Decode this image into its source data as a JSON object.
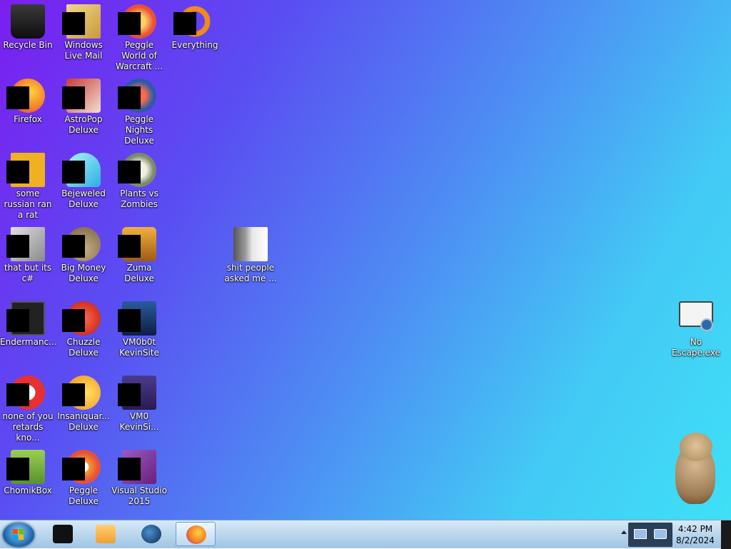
{
  "desktop": {
    "icons": [
      {
        "label": "Recycle Bin",
        "icon": "recycle-bin-icon",
        "color": "#1b1b1b"
      },
      {
        "label": "Windows Live Mail",
        "icon": "mail-icon",
        "color": "#d9b25a"
      },
      {
        "label": "Peggle World of Warcraft ...",
        "icon": "peggle-icon",
        "color": "#e8503a"
      },
      {
        "label": "Everything",
        "icon": "search-icon",
        "color": "#f08a1a"
      },
      {
        "label": "Firefox",
        "icon": "firefox-icon",
        "color": "#f2772a"
      },
      {
        "label": "AstroPop Deluxe",
        "icon": "astropop-icon",
        "color": "#c83a3a"
      },
      {
        "label": "Peggle Nights Deluxe",
        "icon": "peggle-nights-icon",
        "color": "#2a5aa8"
      },
      {
        "label": "some russian ran a rat",
        "icon": "image-icon",
        "color": "#f0b020"
      },
      {
        "label": "Bejeweled Deluxe",
        "icon": "gem-icon",
        "color": "#3ad0f0"
      },
      {
        "label": "Plants vs Zombies",
        "icon": "plant-icon",
        "color": "#8a9a7a"
      },
      {
        "label": "that but its c#",
        "icon": "documents-icon",
        "color": "#b8b8b8"
      },
      {
        "label": "Big Money Deluxe",
        "icon": "money-bag-icon",
        "color": "#b8a07a"
      },
      {
        "label": "Zuma Deluxe",
        "icon": "zuma-icon",
        "color": "#d08a2a"
      },
      {
        "label": "shit people asked me ...",
        "icon": "folder-icon",
        "color": "#8a8a70"
      },
      {
        "label": "Endermanc...",
        "icon": "terminal-icon",
        "color": "#222222"
      },
      {
        "label": "Chuzzle Deluxe",
        "icon": "chuzzle-icon",
        "color": "#d83a2a"
      },
      {
        "label": "VM0b0t KevinSite",
        "icon": "monitor-icon",
        "color": "#1a3a70"
      },
      {
        "label": "No Escape.exe",
        "icon": "monitor-cursor-icon",
        "color": "#f0f0f0"
      },
      {
        "label": "none of you retards kno...",
        "icon": "red-app-icon",
        "color": "#e83030"
      },
      {
        "label": "Insaniquar... Deluxe",
        "icon": "fish-icon",
        "color": "#f0a020"
      },
      {
        "label": "VM0 KevinSi...",
        "icon": "app-icon",
        "color": "#3a2a70"
      },
      {
        "label": "ChomikBox",
        "icon": "hamster-icon",
        "color": "#7ab040"
      },
      {
        "label": "Peggle Deluxe",
        "icon": "peggle-deluxe-icon",
        "color": "#e8503a"
      },
      {
        "label": "Visual Studio 2015",
        "icon": "visual-studio-icon",
        "color": "#68217a"
      }
    ]
  },
  "taskbar": {
    "start_icon": "windows-start-icon",
    "pinned": [
      {
        "icon": "window-icon",
        "color": "#111111",
        "active": false
      },
      {
        "icon": "media-player-icon",
        "color": "#f0a030",
        "active": false
      },
      {
        "icon": "globe-icon",
        "color": "#1d4f8a",
        "active": false
      },
      {
        "icon": "firefox-icon",
        "color": "#f2772a",
        "active": true
      }
    ],
    "clock": {
      "time": "4:42 PM",
      "date": "8/2/2024"
    }
  }
}
